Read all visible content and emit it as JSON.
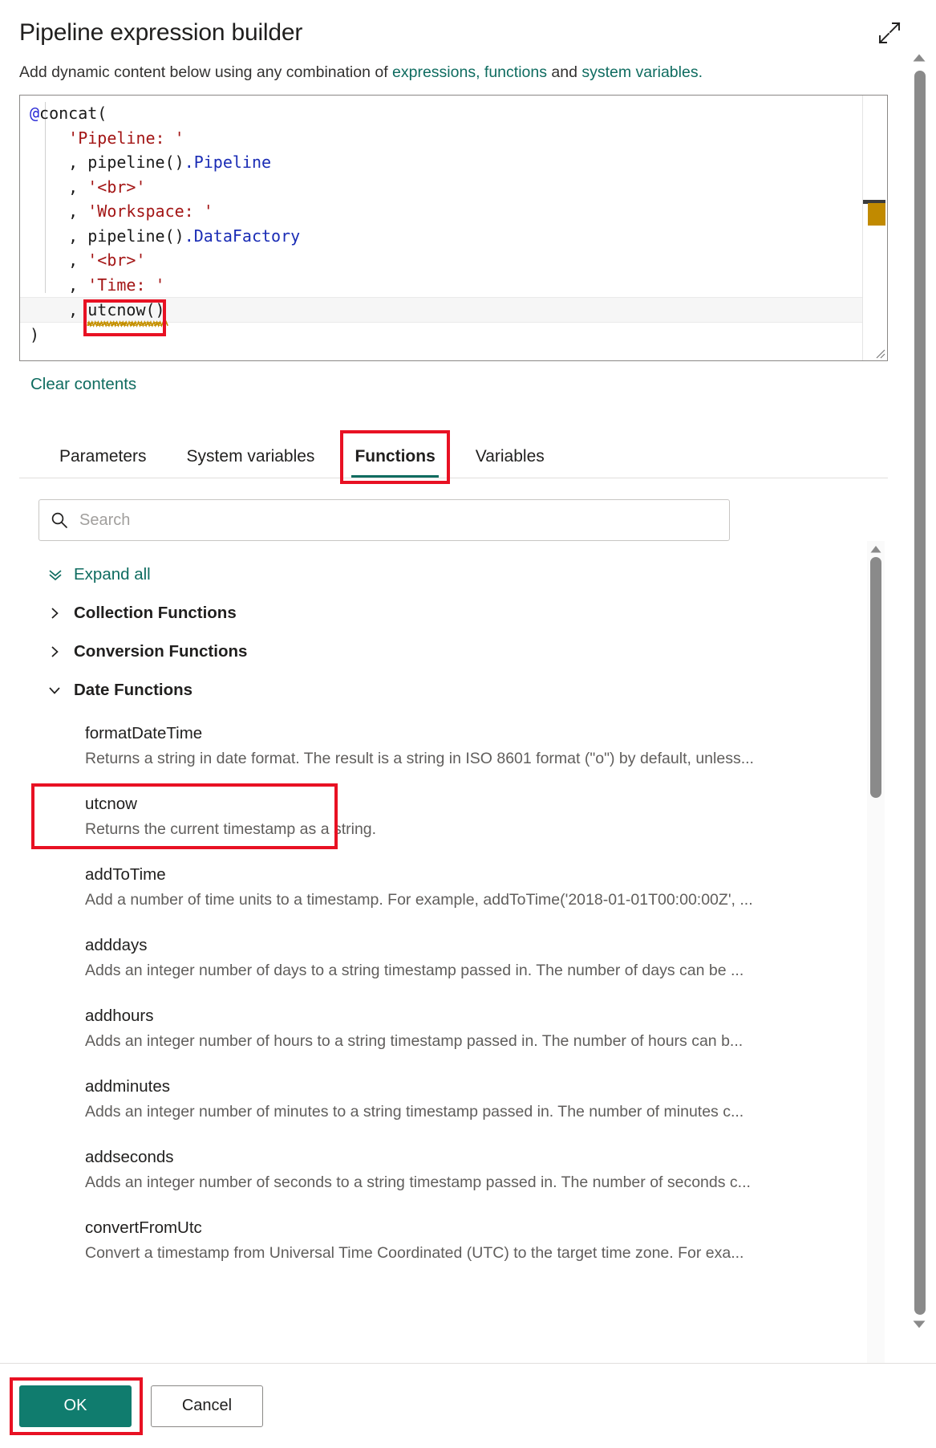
{
  "header": {
    "title": "Pipeline expression builder",
    "expand_icon": "expand-diagonal-icon"
  },
  "subtitle": {
    "prefix": "Add dynamic content below using any combination of ",
    "link1": "expressions,",
    "link2": "functions",
    "middle": " and ",
    "link3": "system variables.",
    "suffix": ""
  },
  "editor": {
    "lines": [
      {
        "indent": 0,
        "tokens": [
          {
            "t": "@",
            "c": "at"
          },
          {
            "t": "concat(",
            "c": "plain"
          }
        ]
      },
      {
        "indent": 1,
        "tokens": [
          {
            "t": "'Pipeline: '",
            "c": "str"
          }
        ]
      },
      {
        "indent": 1,
        "tokens": [
          {
            "t": ", ",
            "c": "comma"
          },
          {
            "t": "pipeline()",
            "c": "plain"
          },
          {
            "t": ".Pipeline",
            "c": "prop"
          }
        ]
      },
      {
        "indent": 1,
        "tokens": [
          {
            "t": ", ",
            "c": "comma"
          },
          {
            "t": "'<br>'",
            "c": "str"
          }
        ]
      },
      {
        "indent": 1,
        "tokens": [
          {
            "t": ", ",
            "c": "comma"
          },
          {
            "t": "'Workspace: '",
            "c": "str"
          }
        ]
      },
      {
        "indent": 1,
        "tokens": [
          {
            "t": ", ",
            "c": "comma"
          },
          {
            "t": "pipeline()",
            "c": "plain"
          },
          {
            "t": ".DataFactory",
            "c": "prop"
          }
        ]
      },
      {
        "indent": 1,
        "tokens": [
          {
            "t": ", ",
            "c": "comma"
          },
          {
            "t": "'<br>'",
            "c": "str"
          }
        ]
      },
      {
        "indent": 1,
        "tokens": [
          {
            "t": ", ",
            "c": "comma"
          },
          {
            "t": "'Time: '",
            "c": "str"
          }
        ]
      },
      {
        "indent": 1,
        "current": true,
        "tokens": [
          {
            "t": ", ",
            "c": "comma"
          },
          {
            "t": "utcnow()",
            "c": "plain",
            "squiggle": true,
            "annotated": true
          }
        ]
      },
      {
        "indent": 0,
        "tokens": [
          {
            "t": ")",
            "c": "plain"
          }
        ]
      }
    ],
    "raw_text": "@concat(\n    'Pipeline: '\n    , pipeline().Pipeline\n    , '<br>'\n    , 'Workspace: '\n    , pipeline().DataFactory\n    , '<br>'\n    , 'Time: '\n    , utcnow()\n)"
  },
  "clear_contents_label": "Clear contents",
  "tabs": [
    {
      "label": "Parameters",
      "active": false
    },
    {
      "label": "System variables",
      "active": false
    },
    {
      "label": "Functions",
      "active": true,
      "annotated": true
    },
    {
      "label": "Variables",
      "active": false
    }
  ],
  "search": {
    "placeholder": "Search",
    "value": "",
    "icon": "search-icon"
  },
  "expand_all": {
    "label": "Expand all",
    "icon": "double-chevron-down-icon"
  },
  "groups": [
    {
      "name": "Collection Functions",
      "expanded": false,
      "icon": "chevron-right-icon",
      "functions": []
    },
    {
      "name": "Conversion Functions",
      "expanded": false,
      "icon": "chevron-right-icon",
      "functions": []
    },
    {
      "name": "Date Functions",
      "expanded": true,
      "icon": "chevron-down-icon",
      "functions": [
        {
          "name": "formatDateTime",
          "description": "Returns a string in date format. The result is a string in ISO 8601 format (\"o\") by default, unless..."
        },
        {
          "name": "utcnow",
          "description": "Returns the current timestamp as a string.",
          "annotated": true
        },
        {
          "name": "addToTime",
          "description": "Add a number of time units to a timestamp. For example, addToTime('2018-01-01T00:00:00Z', ..."
        },
        {
          "name": "adddays",
          "description": "Adds an integer number of days to a string timestamp passed in. The number of days can be ..."
        },
        {
          "name": "addhours",
          "description": "Adds an integer number of hours to a string timestamp passed in. The number of hours can b..."
        },
        {
          "name": "addminutes",
          "description": "Adds an integer number of minutes to a string timestamp passed in. The number of minutes c..."
        },
        {
          "name": "addseconds",
          "description": "Adds an integer number of seconds to a string timestamp passed in. The number of seconds c..."
        },
        {
          "name": "convertFromUtc",
          "description": "Convert a timestamp from Universal Time Coordinated (UTC) to the target time zone. For exa..."
        }
      ]
    }
  ],
  "footer": {
    "ok_label": "OK",
    "cancel_label": "Cancel",
    "ok_annotated": true
  },
  "colors": {
    "accent_teal": "#0f6c60",
    "primary_button": "#107c6e",
    "annotation_red": "#e81123",
    "string_literal": "#a31515",
    "property": "#1a2cb5",
    "at_sign": "#2b2bd6",
    "squiggle": "#c18a00",
    "marker": "#c18a00"
  }
}
